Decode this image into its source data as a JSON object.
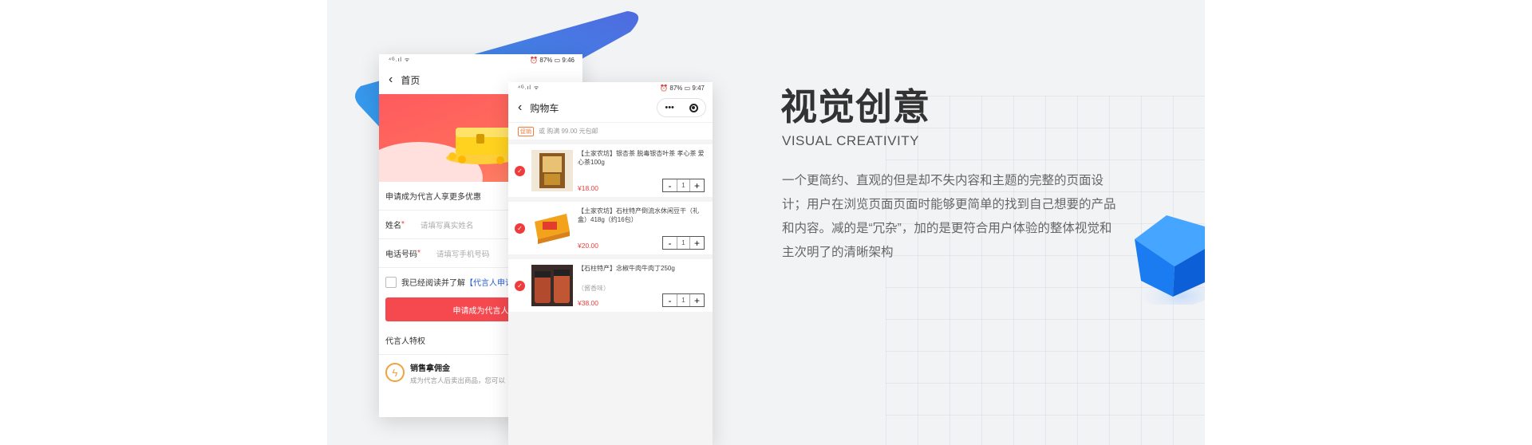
{
  "phone1": {
    "status": {
      "signal": "⁴ᴳ.ıl ᯤ",
      "right": "⏰ 87% ▭ 9:46"
    },
    "nav_title": "首页",
    "benefit_text": "申请成为代言人享更多优惠",
    "name_label": "姓名",
    "name_placeholder": "请填写真实姓名",
    "phone_label": "电话号码",
    "phone_placeholder": "请填写手机号码",
    "required_mark": "*",
    "agree_text": "我已经阅读并了解",
    "agree_link": "【代言人申请",
    "apply_button": "申请成为代言人",
    "privileges_title": "代言人特权",
    "privilege": {
      "title": "销售拿佣金",
      "desc": "成为代言人后卖出商品，您可以"
    }
  },
  "phone2": {
    "status": {
      "signal": "⁴ᴳ.ıl ᯤ",
      "right": "⏰ 87% ▭ 9:47"
    },
    "nav_title": "购物车",
    "capsule_more": "•••",
    "promo_tag": "促销",
    "promo_text": "或 购满 99.00 元包邮",
    "items": [
      {
        "name": "【土家农坊】银杏茶 脱毒银杏叶茶 孝心茶 爱心茶100g",
        "spec": "",
        "price": "¥18.00",
        "qty": "1"
      },
      {
        "name": "【土家农坊】石柱特产倒流水休闲豆干（礼盒）418g（约16包）",
        "spec": "",
        "price": "¥20.00",
        "qty": "1"
      },
      {
        "name": "【石柱特产】念椒牛肉牛肉丁250g",
        "spec": "（酱香味）",
        "price": "¥38.00",
        "qty": "1"
      }
    ],
    "minus": "-",
    "plus": "+"
  },
  "text": {
    "headline": "视觉创意",
    "subline": "VISUAL CREATIVITY",
    "desc": "一个更简约、直观的但是却不失内容和主题的完整的页面设计；用户在浏览页面页面时能够更简单的找到自己想要的产品和内容。减的是“冗杂”，加的是更符合用户体验的整体视觉和主次明了的清晰架构"
  },
  "colors": {
    "accent_red": "#f5484f",
    "triangle_start": "#2fa4ef",
    "triangle_end": "#4f6fe0",
    "cube": "#1a7cf0"
  }
}
